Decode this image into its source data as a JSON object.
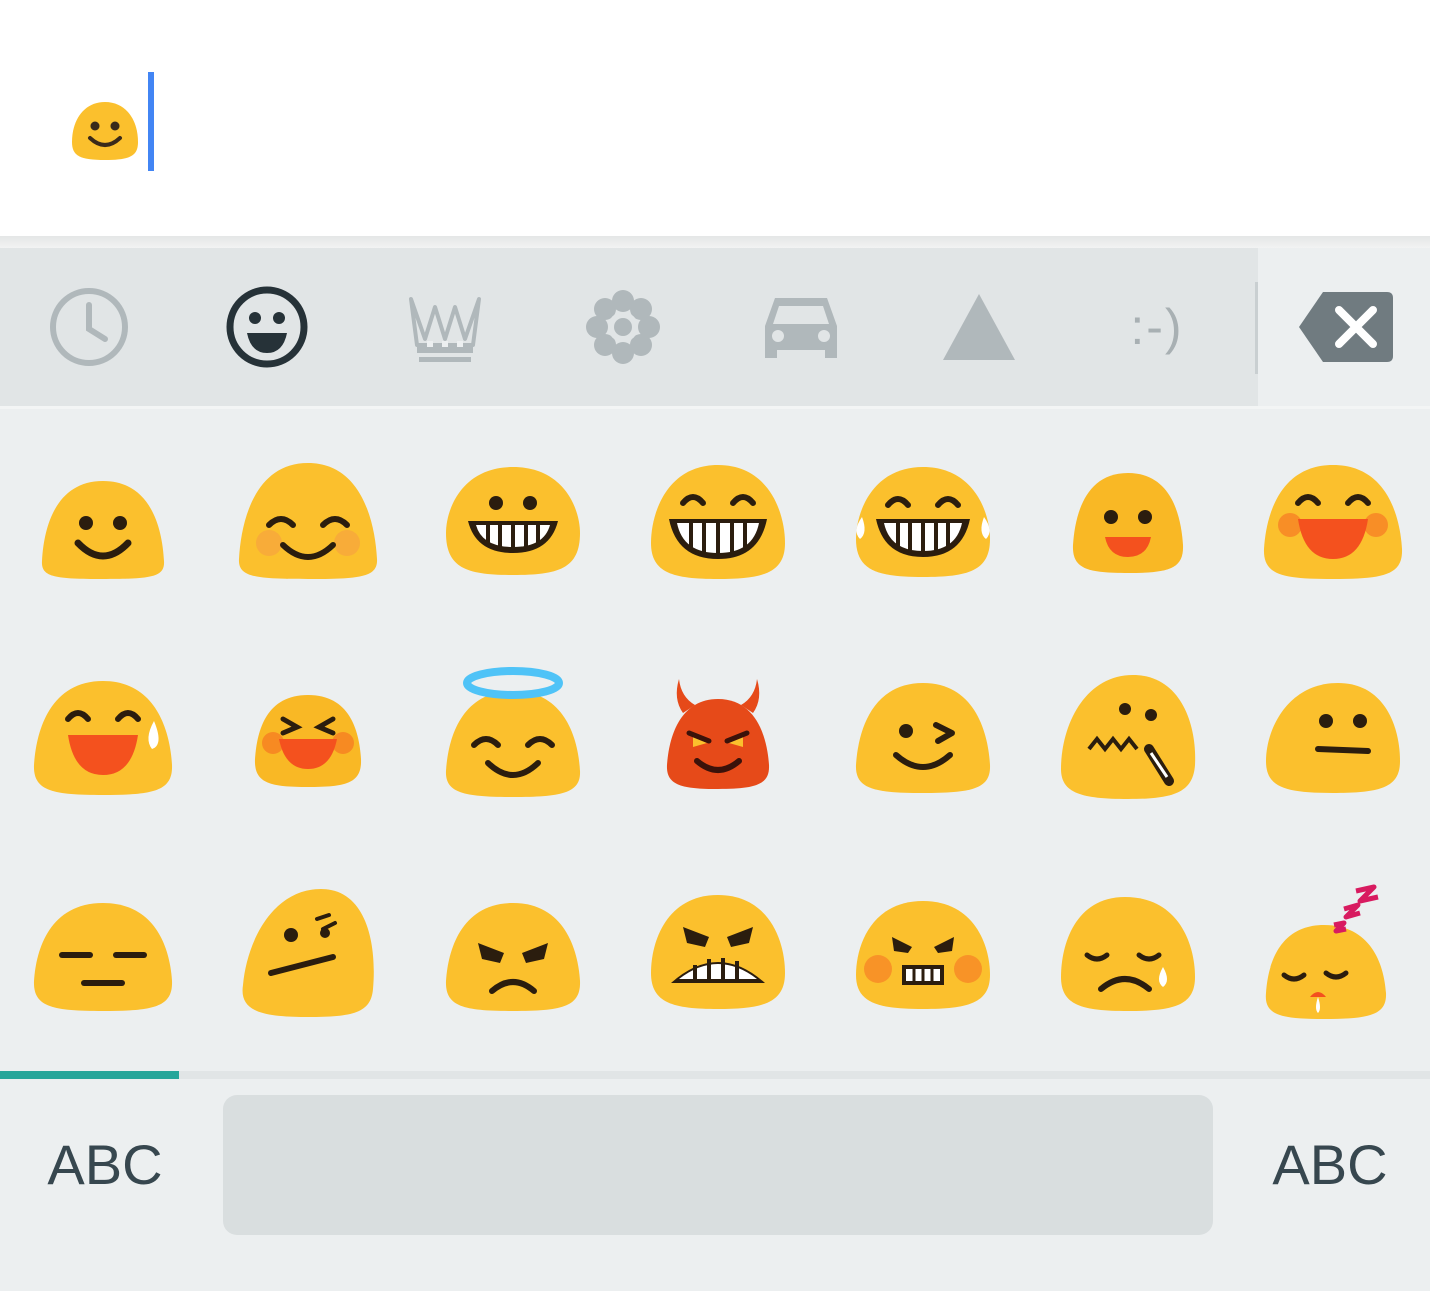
{
  "text_field": {
    "content_emoji": "smiling-face-icon",
    "cursor_color": "#4285f4"
  },
  "category_bar": {
    "tabs": [
      {
        "name": "recent",
        "icon": "clock-icon",
        "active": false
      },
      {
        "name": "people",
        "icon": "smiley-icon",
        "active": true
      },
      {
        "name": "objects",
        "icon": "crown-icon",
        "active": false
      },
      {
        "name": "nature",
        "icon": "flower-icon",
        "active": false
      },
      {
        "name": "places",
        "icon": "car-icon",
        "active": false
      },
      {
        "name": "symbols",
        "icon": "triangle-icon",
        "active": false
      },
      {
        "name": "emoticons",
        "label": ":-)",
        "active": false
      }
    ],
    "backspace_icon": "backspace-icon",
    "active_color": "#263238",
    "inactive_color": "#a8b0b3"
  },
  "emoji_grid": {
    "rows": [
      [
        "grinning-face",
        "smiling-face-smiling-eyes",
        "grinning-teeth-face",
        "grinning-smiling-eyes",
        "tears-of-joy-face",
        "open-mouth-smile",
        "laughing-face"
      ],
      [
        "sweat-smile-face",
        "squinting-laughing-face",
        "halo-face",
        "smiling-imp-face",
        "winking-face",
        "zipper-mouth-face",
        "neutral-face"
      ],
      [
        "expressionless-face",
        "confused-face",
        "angry-face",
        "grimacing-angry-face",
        "pouting-face",
        "sad-tear-face",
        "sleeping-face"
      ]
    ],
    "emoji_color": "#fbc02d",
    "devil_color": "#e64a19"
  },
  "page_indicator": {
    "pages": 8,
    "current": 1,
    "active_color": "#26a69a"
  },
  "bottom_row": {
    "abc_left": "ABC",
    "abc_right": "ABC"
  }
}
